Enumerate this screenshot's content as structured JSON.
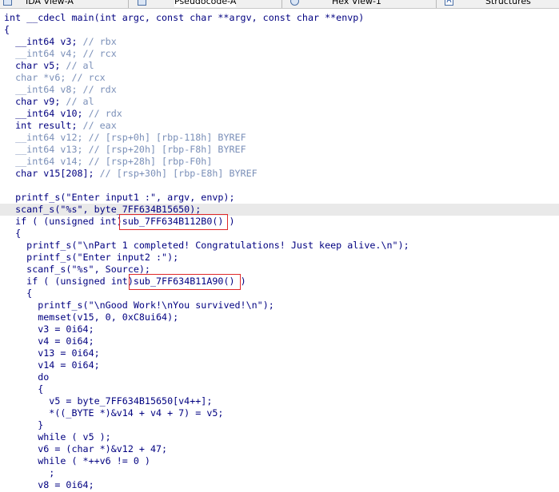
{
  "tabs": [
    {
      "label": "IDA View-A",
      "icon": "ida-view-icon"
    },
    {
      "label": "Pseudocode-A",
      "icon": "pseudocode-icon"
    },
    {
      "label": "Hex View-1",
      "icon": "hex-view-icon"
    },
    {
      "label": "Structures",
      "icon": "structures-icon"
    }
  ],
  "tab_icon_letter": "A",
  "code": {
    "signature": "int __cdecl main(int argc, const char **argv, const char **envp)",
    "brace_open": "{",
    "decls": [
      {
        "type": "__int64 v3;",
        "comment": "// rbx"
      },
      {
        "type": "__int64 v4;",
        "comment": "// rcx"
      },
      {
        "type": "char v5;",
        "comment": "// al"
      },
      {
        "type": "char *v6;",
        "comment": "// rcx"
      },
      {
        "type": "__int64 v8;",
        "comment": "// rdx"
      },
      {
        "type": "char v9;",
        "comment": "// al"
      },
      {
        "type": "__int64 v10;",
        "comment": "// rdx"
      },
      {
        "type": "int result;",
        "comment": "// eax"
      },
      {
        "type": "__int64 v12;",
        "comment": "// [rsp+0h] [rbp-118h] BYREF"
      },
      {
        "type": "__int64 v13;",
        "comment": "// [rsp+20h] [rbp-F8h] BYREF"
      },
      {
        "type": "__int64 v14;",
        "comment": "// [rsp+28h] [rbp-F0h]"
      },
      {
        "type": "char v15[208];",
        "comment": "// [rsp+30h] [rbp-E8h] BYREF"
      }
    ],
    "l_printf1": "printf_s(\"Enter input1 :\", argv, envp);",
    "l_scanf1": "scanf_s(\"%s\", byte_7FF634B15650);",
    "l_if1_pre": "if ( (unsigned int)",
    "l_if1_call": "sub_7FF634B112B0()",
    "l_if1_post": " )",
    "l_brace2": "{",
    "l_printf2": "printf_s(\"\\nPart 1 completed! Congratulations! Just keep alive.\\n\");",
    "l_printf3": "printf_s(\"Enter input2 :\");",
    "l_scanf2": "scanf_s(\"%s\", Source);",
    "l_if2_pre": "if ( (unsigned int)",
    "l_if2_call": "sub_7FF634B11A90()",
    "l_if2_post": " )",
    "l_brace3": "{",
    "l_printf4": "printf_s(\"\\nGood Work!\\nYou survived!\\n\");",
    "l_memset": "memset(v15, 0, 0xC8ui64);",
    "l_v3": "v3 = 0i64;",
    "l_v4": "v4 = 0i64;",
    "l_v13": "v13 = 0i64;",
    "l_v14": "v14 = 0i64;",
    "l_do": "do",
    "l_brace4": "{",
    "l_v5": "v5 = byte_7FF634B15650[v4++];",
    "l_byte": "*((_BYTE *)&v14 + v4 + 7) = v5;",
    "l_brace4c": "}",
    "l_while1": "while ( v5 );",
    "l_v6": "v6 = (char *)&v12 + 47;",
    "l_while2": "while ( *++v6 != 0 )",
    "l_semi": ";",
    "l_v8": "v8 = 0i64;"
  }
}
